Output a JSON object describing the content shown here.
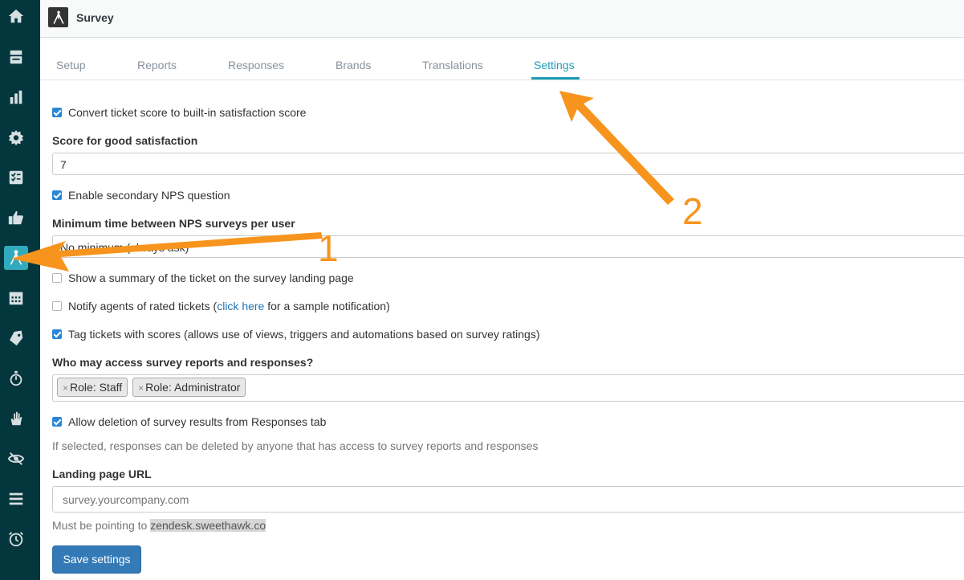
{
  "header": {
    "title": "Survey"
  },
  "tabs": [
    {
      "label": "Setup"
    },
    {
      "label": "Reports"
    },
    {
      "label": "Responses"
    },
    {
      "label": "Brands"
    },
    {
      "label": "Translations"
    },
    {
      "label": "Settings",
      "active": true
    }
  ],
  "form": {
    "convert_score": {
      "label": "Convert ticket score to built-in satisfaction score",
      "checked": true
    },
    "good_score": {
      "label": "Score for good satisfaction",
      "value": "7"
    },
    "nps": {
      "label": "Enable secondary NPS question",
      "checked": true
    },
    "nps_interval": {
      "label": "Minimum time between NPS surveys per user",
      "value": "No minimum (always ask)"
    },
    "summary": {
      "label": "Show a summary of the ticket on the survey landing page",
      "checked": false
    },
    "notify": {
      "label_prefix": "Notify agents of rated tickets (",
      "link": "click here",
      "label_suffix": " for a sample notification)",
      "checked": false
    },
    "tag": {
      "label": "Tag tickets with scores (allows use of views, triggers and automations based on survey ratings)",
      "checked": true
    },
    "access": {
      "label": "Who may access survey reports and responses?",
      "tags": [
        "Role: Staff",
        "Role: Administrator"
      ],
      "remove_glyph": "×"
    },
    "deletion": {
      "label": "Allow deletion of survey results from Responses tab",
      "checked": true,
      "help": "If selected, responses can be deleted by anyone that has access to survey reports and responses"
    },
    "landing": {
      "label": "Landing page URL",
      "placeholder": "survey.yourcompany.com",
      "help_prefix": "Must be pointing to ",
      "help_domain": "zendesk.sweethawk.co"
    },
    "save_label": "Save settings"
  },
  "annotations": {
    "one": "1",
    "two": "2",
    "color": "#f7941d"
  },
  "sidebar": {
    "icons": [
      "home-icon",
      "views-icon",
      "reporting-icon",
      "admin-gear-icon",
      "tasks-icon",
      "thumbs-up-icon",
      "survey-tripod-icon",
      "calendar-icon",
      "ticket-tag-icon",
      "timer-icon",
      "hand-icon",
      "eye-slash-icon",
      "list-icon",
      "alarm-clock-icon"
    ],
    "active": "survey-tripod-icon",
    "color": "#03363d",
    "accent": "#30aabc"
  }
}
